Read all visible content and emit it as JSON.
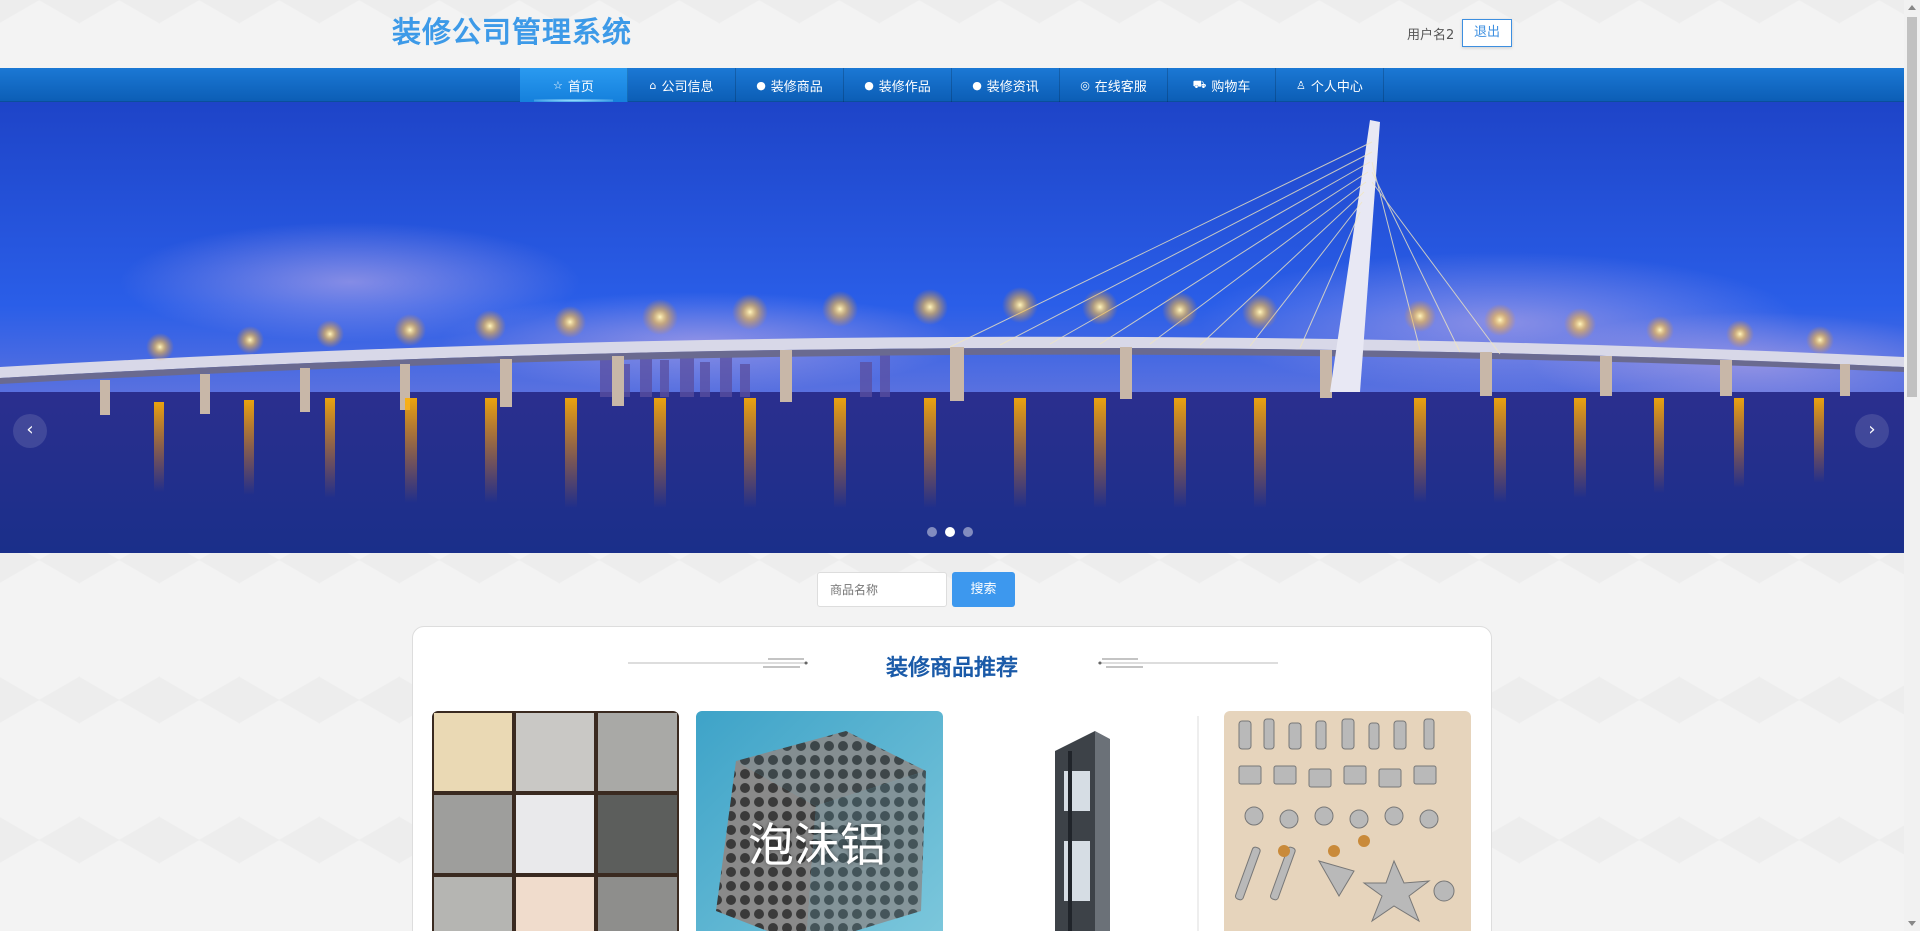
{
  "header": {
    "title": "装修公司管理系统",
    "username": "用户名2",
    "logout_label": "退出"
  },
  "nav": {
    "items": [
      {
        "label": "首页",
        "icon": "star-icon",
        "glyph": "☆",
        "active": true
      },
      {
        "label": "公司信息",
        "icon": "bag-icon",
        "glyph": "⌂"
      },
      {
        "label": "装修商品",
        "icon": "info-icon",
        "glyph": "●"
      },
      {
        "label": "装修作品",
        "icon": "question-icon",
        "glyph": "●"
      },
      {
        "label": "装修资讯",
        "icon": "info-icon",
        "glyph": "●"
      },
      {
        "label": "在线客服",
        "icon": "headset-icon",
        "glyph": "◎"
      },
      {
        "label": "购物车",
        "icon": "cart-icon",
        "glyph": "⛟"
      },
      {
        "label": "个人中心",
        "icon": "user-icon",
        "glyph": "♙"
      }
    ]
  },
  "banner": {
    "prev_glyph": "‹",
    "next_glyph": "›",
    "slide_count": 3,
    "active_slide": 2
  },
  "search": {
    "placeholder": "商品名称",
    "button_label": "搜索"
  },
  "recommend": {
    "title": "装修商品推荐",
    "products": [
      {
        "name": "tiles"
      },
      {
        "name": "foam-aluminum",
        "overlay_text": "泡沫铝"
      },
      {
        "name": "window-profile"
      },
      {
        "name": "hardware-fittings"
      }
    ]
  },
  "colors": {
    "accent": "#3d9ae8",
    "nav_bg": "#1b78d4",
    "title_blue": "#1a5aa8"
  }
}
